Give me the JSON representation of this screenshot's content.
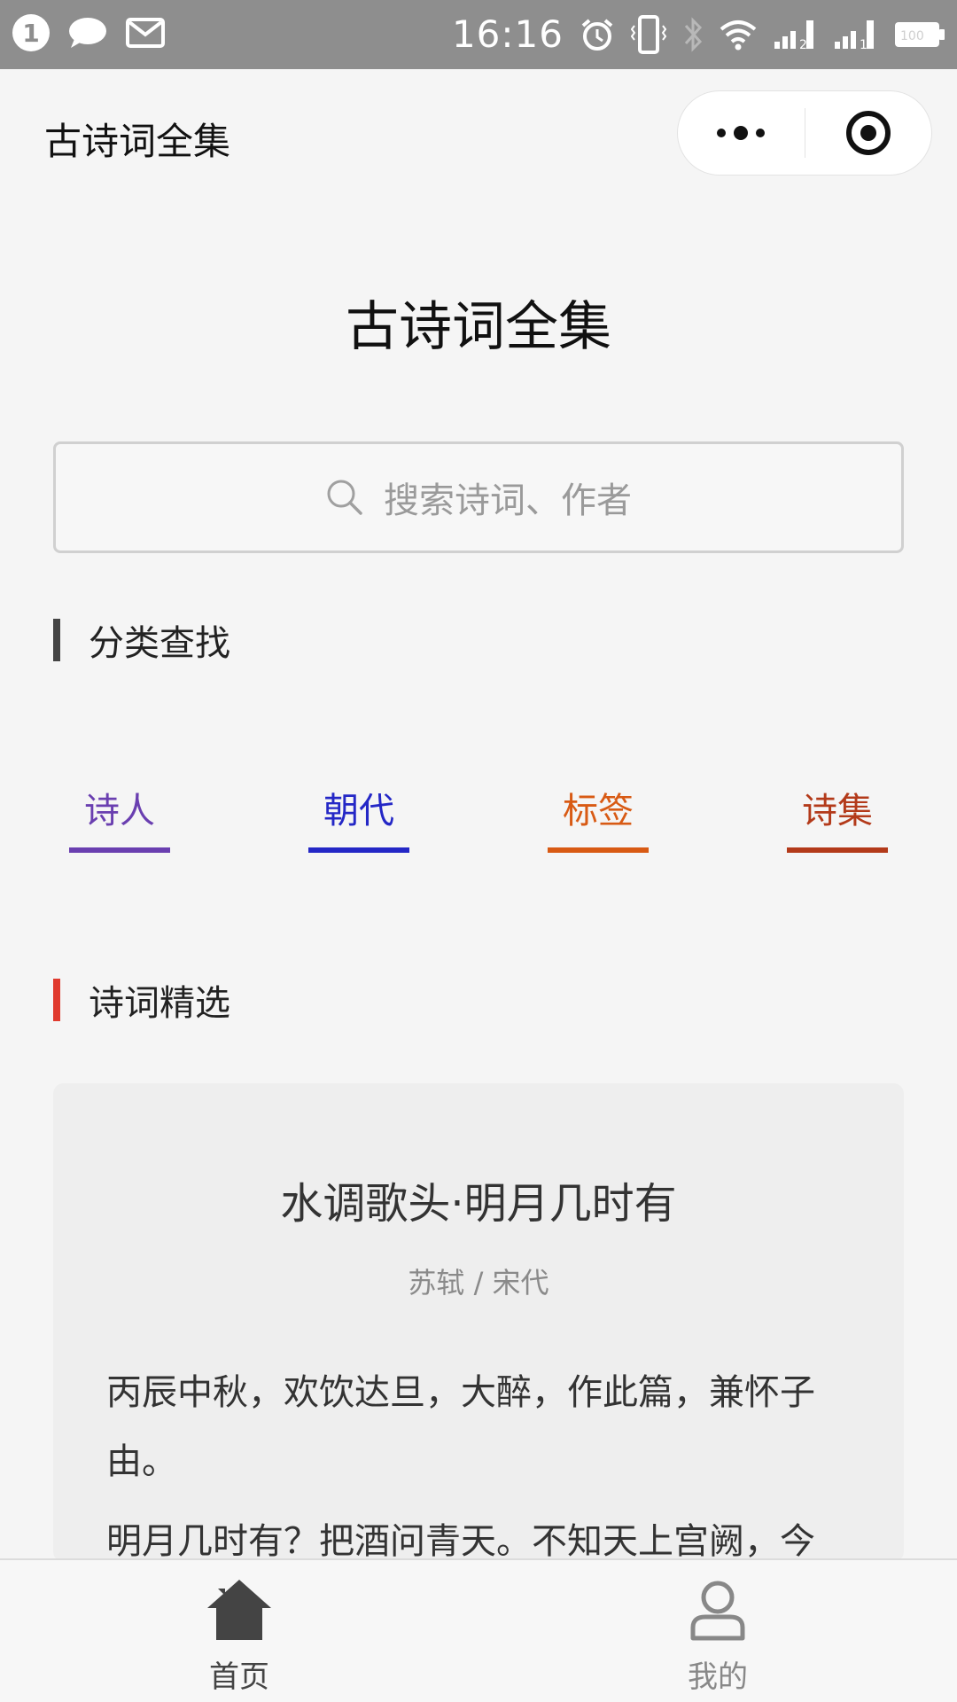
{
  "status_bar": {
    "notification_count": "1",
    "time": "16:16",
    "battery": "100"
  },
  "nav": {
    "title": "古诗词全集"
  },
  "hero": {
    "title": "古诗词全集"
  },
  "search": {
    "placeholder": "搜索诗词、作者"
  },
  "sections": {
    "category_title": "分类查找",
    "featured_title": "诗词精选"
  },
  "categories": [
    {
      "label": "诗人",
      "color": "#6a3fb0"
    },
    {
      "label": "朝代",
      "color": "#2427c6"
    },
    {
      "label": "标签",
      "color": "#d85a14"
    },
    {
      "label": "诗集",
      "color": "#b33a1a"
    }
  ],
  "poem": {
    "title": "水调歌头·明月几时有",
    "meta": "苏轼 / 宋代",
    "preface": "丙辰中秋，欢饮达旦，大醉，作此篇，兼怀子由。",
    "line1": "明月几时有？把酒问青天。不知天上宫阙，今"
  },
  "tabbar": {
    "home_label": "首页",
    "mine_label": "我的"
  },
  "colors": {
    "category_bar": "#444444",
    "featured_bar": "#e03a2e",
    "tab_active": "#444444",
    "tab_inactive": "#888888"
  }
}
